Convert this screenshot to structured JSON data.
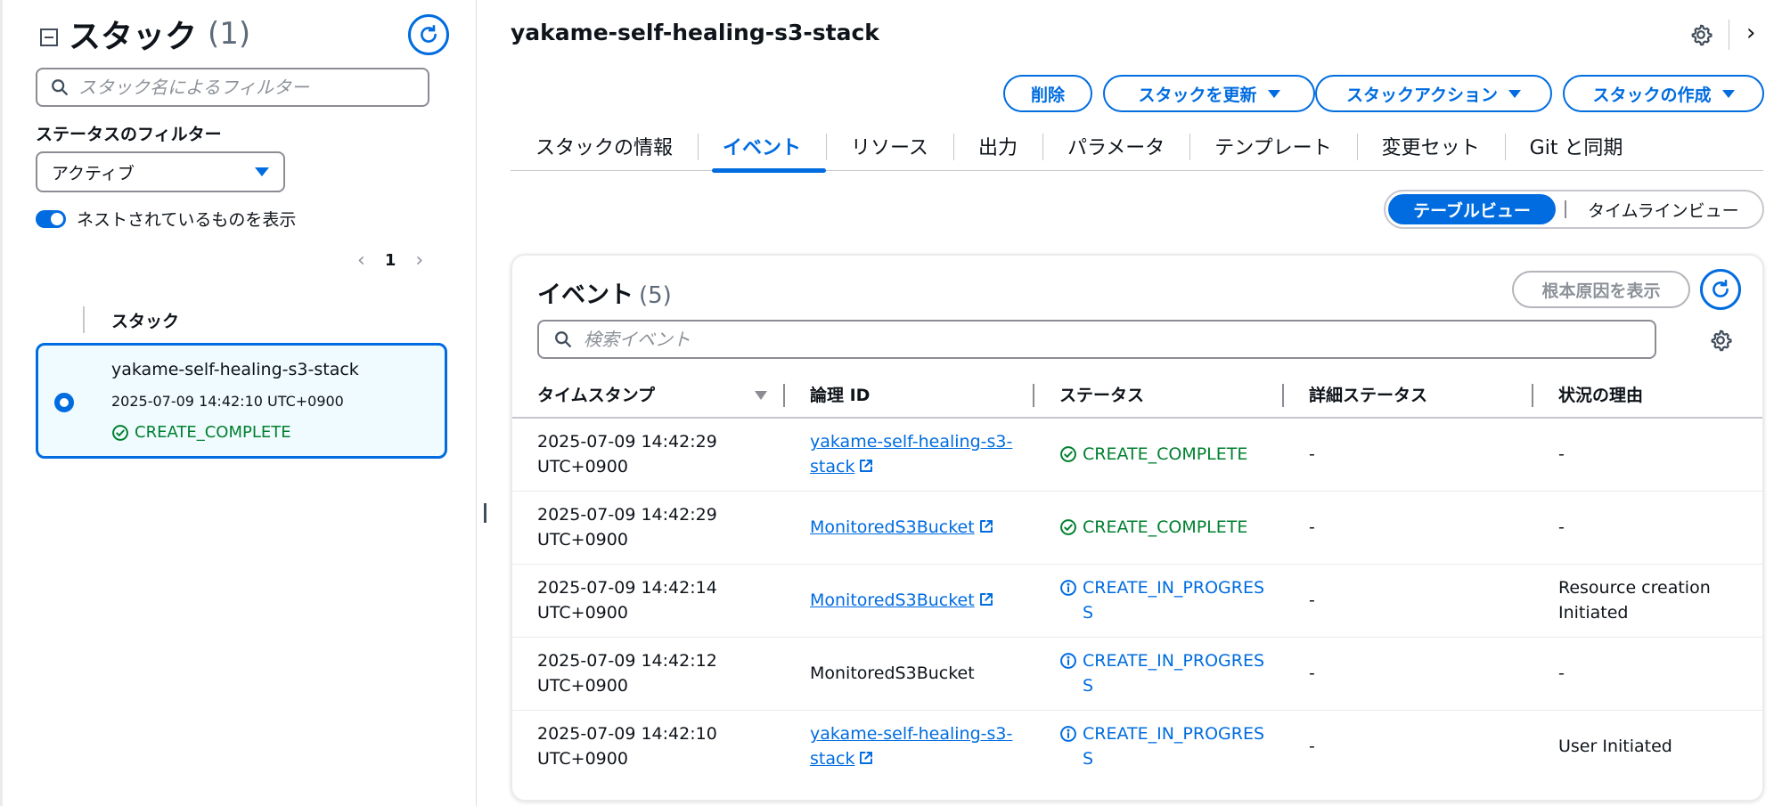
{
  "left_panel": {
    "title": "スタック",
    "count": "(1)",
    "search_placeholder": "スタック名によるフィルター",
    "status_filter_label": "ステータスのフィルター",
    "status_filter_value": "アクティブ",
    "nested_toggle_label": "ネストされているものを表示",
    "nested_toggle_on": true,
    "page_number": "1",
    "column_header": "スタック",
    "stack": {
      "name": "yakame-self-healing-s3-stack",
      "time": "2025-07-09 14:42:10 UTC+0900",
      "status": "CREATE_COMPLETE"
    }
  },
  "header": {
    "stack_title": "yakame-self-healing-s3-stack",
    "buttons": {
      "delete": "削除",
      "update": "スタックを更新",
      "actions": "スタックアクション",
      "create": "スタックの作成"
    }
  },
  "tabs": [
    "スタックの情報",
    "イベント",
    "リソース",
    "出力",
    "パラメータ",
    "テンプレート",
    "変更セット",
    "Git と同期"
  ],
  "active_tab_index": 1,
  "view_switch": {
    "table": "テーブルビュー",
    "timeline": "タイムラインビュー"
  },
  "events": {
    "title": "イベント",
    "count": "(5)",
    "root_cause_button": "根本原因を表示",
    "search_placeholder": "検索イベント",
    "columns": [
      "タイムスタンプ",
      "論理 ID",
      "ステータス",
      "詳細ステータス",
      "状況の理由"
    ],
    "rows": [
      {
        "timestamp": "2025-07-09 14:42:29 UTC+0900",
        "logical_id": "yakame-self-healing-s3-stack",
        "logical_link": true,
        "status": "CREATE_COMPLETE",
        "status_kind": "success",
        "detail": "-",
        "reason": "-"
      },
      {
        "timestamp": "2025-07-09 14:42:29 UTC+0900",
        "logical_id": "MonitoredS3Bucket",
        "logical_link": true,
        "status": "CREATE_COMPLETE",
        "status_kind": "success",
        "detail": "-",
        "reason": "-"
      },
      {
        "timestamp": "2025-07-09 14:42:14 UTC+0900",
        "logical_id": "MonitoredS3Bucket",
        "logical_link": true,
        "status": "CREATE_IN_PROGRESS",
        "status_kind": "info",
        "detail": "-",
        "reason": "Resource creation Initiated"
      },
      {
        "timestamp": "2025-07-09 14:42:12 UTC+0900",
        "logical_id": "MonitoredS3Bucket",
        "logical_link": false,
        "status": "CREATE_IN_PROGRESS",
        "status_kind": "info",
        "detail": "-",
        "reason": "-"
      },
      {
        "timestamp": "2025-07-09 14:42:10 UTC+0900",
        "logical_id": "yakame-self-healing-s3-stack",
        "logical_link": true,
        "status": "CREATE_IN_PROGRESS",
        "status_kind": "info",
        "detail": "-",
        "reason": "User Initiated"
      }
    ]
  },
  "colors": {
    "accent": "#006ce0",
    "success": "#00802f",
    "text": "#0f141a",
    "muted": "#5f6b7a"
  }
}
